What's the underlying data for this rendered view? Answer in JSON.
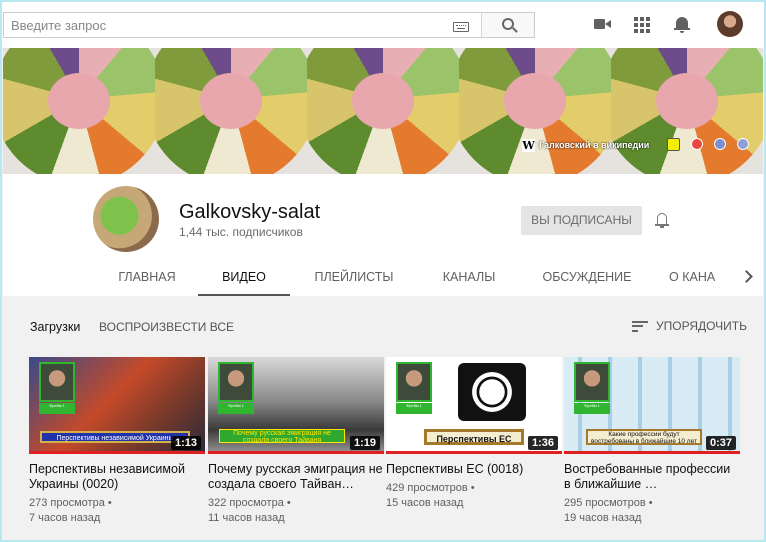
{
  "search": {
    "placeholder": "Введите запрос"
  },
  "topbar_icons": [
    "keyboard-icon",
    "search-icon",
    "video-camera-icon",
    "apps-icon",
    "bell-icon",
    "avatar"
  ],
  "banner": {
    "wiki_label": "Галковский в википедии",
    "colors": {
      "yellow": "#f4ee00",
      "red": "#e8463a",
      "blue": "#7b8fd1"
    }
  },
  "channel": {
    "name": "Galkovsky-salat",
    "subscribers": "1,44 тыс. подписчиков",
    "subscribe_label": "ВЫ ПОДПИСАНЫ"
  },
  "tabs": [
    {
      "label": "ГЛАВНАЯ",
      "active": false
    },
    {
      "label": "ВИДЕО",
      "active": true
    },
    {
      "label": "ПЛЕЙЛИСТЫ",
      "active": false
    },
    {
      "label": "КАНАЛЫ",
      "active": false
    },
    {
      "label": "ОБСУЖДЕНИЕ",
      "active": false
    },
    {
      "label": "О КАНА",
      "active": false
    }
  ],
  "section": {
    "title": "Загрузки",
    "play_all": "ВОСПРОИЗВЕСТИ ВСЕ",
    "sort": "УПОРЯДОЧИТЬ"
  },
  "videos": [
    {
      "title": "Перспективы независимой Украины (0020)",
      "views": "273 просмотра •",
      "age": "7 часов назад",
      "duration": "1:13",
      "caption": "Перспективы независимой Украины",
      "tag": "Фрейм 1"
    },
    {
      "title": "Почему русская эмиграция не создала своего Тайван…",
      "views": "322 просмотра •",
      "age": "11 часов назад",
      "duration": "1:19",
      "caption": "Почему русская эмиграция не создала своего Тайваня",
      "tag": "Фрейм 1"
    },
    {
      "title": "Перспективы ЕС (0018)",
      "views": "429 просмотров •",
      "age": "15 часов назад",
      "duration": "1:36",
      "caption": "Перспективы ЕС",
      "tag": "Фрейм 1"
    },
    {
      "title": "Востребованные профессии в ближайшие …",
      "views": "295 просмотров •",
      "age": "19 часов назад",
      "duration": "0:37",
      "caption": "Какие профессии будут востребованы в ближайшие 10 лет",
      "tag": "Фрейм 1"
    }
  ]
}
